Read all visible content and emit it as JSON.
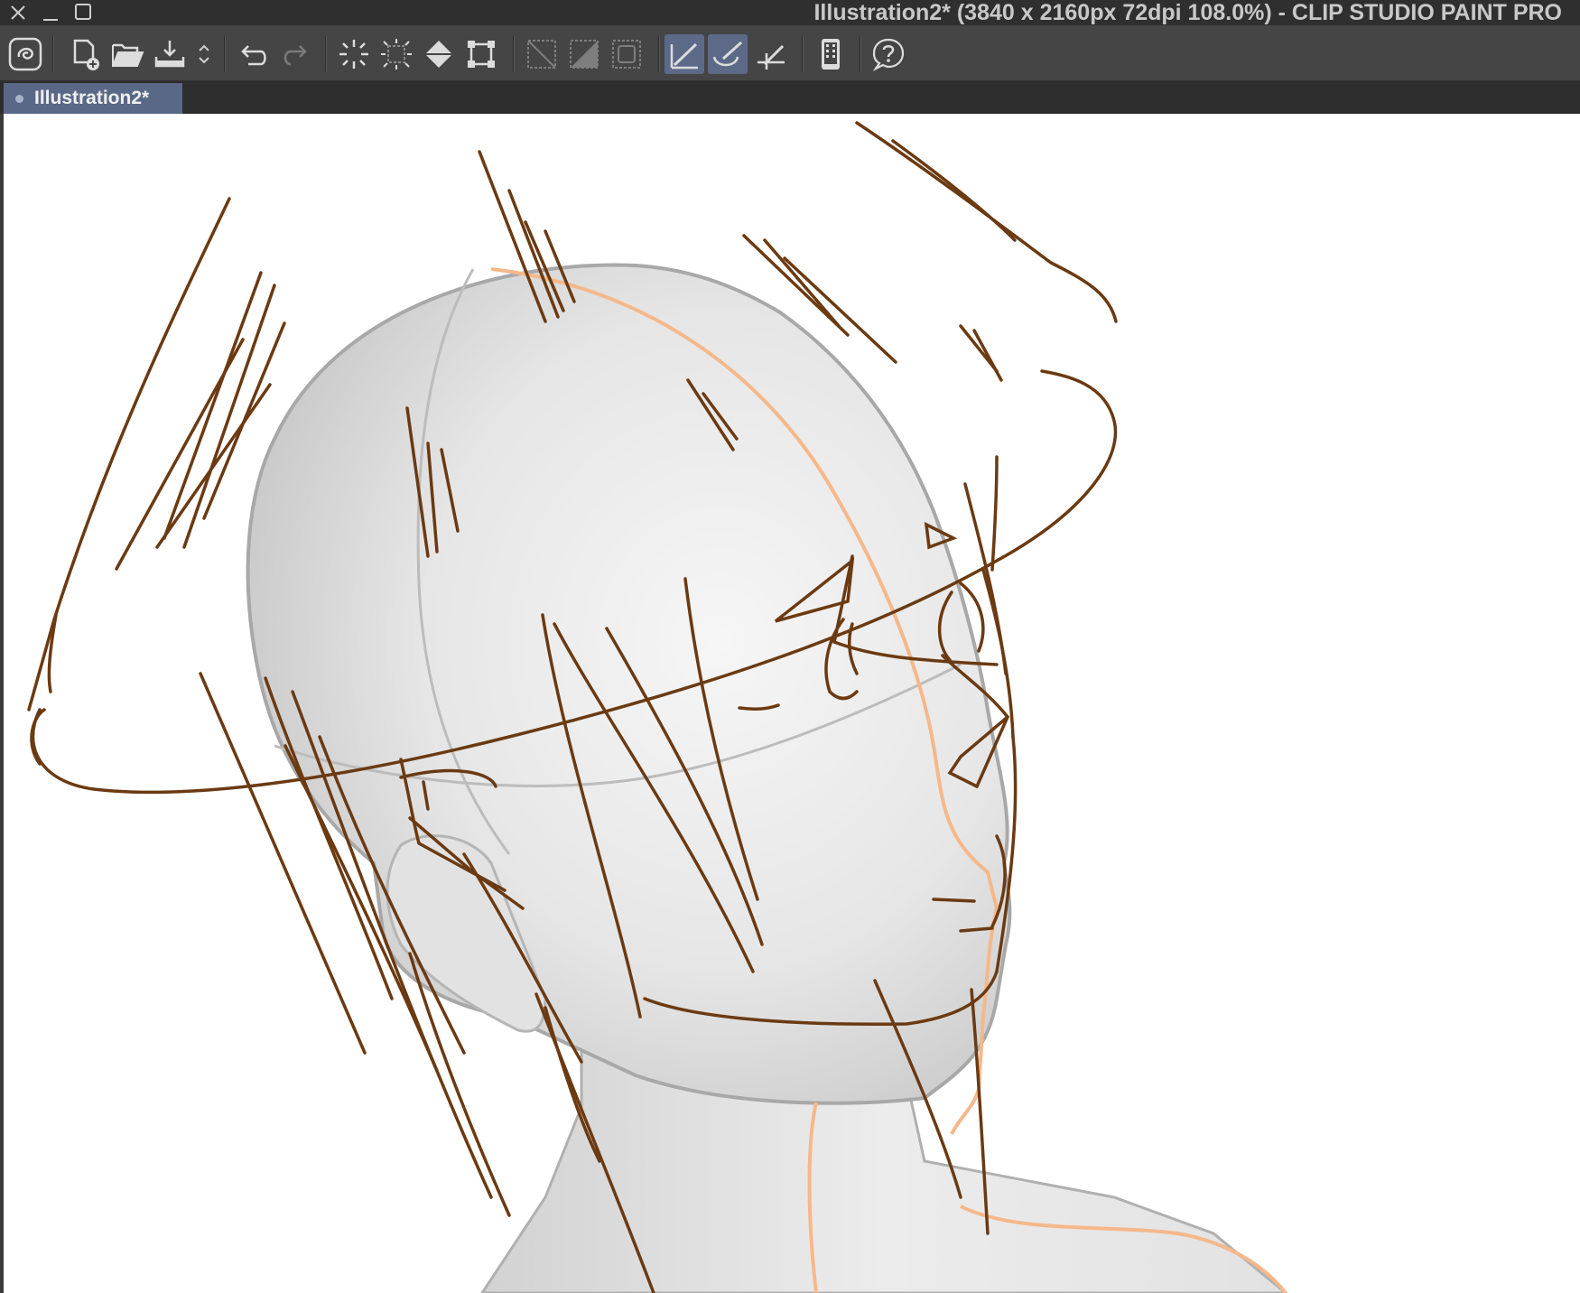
{
  "window": {
    "title": "Illustration2* (3840 x 2160px 72dpi 108.0%)  - CLIP STUDIO PAINT PRO",
    "controls": [
      "close-icon",
      "minimize-icon",
      "maximize-icon"
    ]
  },
  "toolbar": {
    "buttons": [
      {
        "name": "clip-studio-button",
        "icon": "swirl-logo-icon"
      },
      {
        "name": "new-button",
        "icon": "new-file-icon"
      },
      {
        "name": "open-button",
        "icon": "folder-open-icon"
      },
      {
        "name": "save-button",
        "icon": "save-icon"
      },
      {
        "name": "undo-button",
        "icon": "undo-icon"
      },
      {
        "name": "redo-button",
        "icon": "redo-icon"
      },
      {
        "name": "clear-button",
        "icon": "clear-burst-icon"
      },
      {
        "name": "clear-outside-selection-button",
        "icon": "clear-outside-icon"
      },
      {
        "name": "fill-button",
        "icon": "fill-bucket-icon"
      },
      {
        "name": "transform-button",
        "icon": "transform-icon"
      },
      {
        "name": "deselect-button",
        "icon": "deselect-icon"
      },
      {
        "name": "invert-selection-button",
        "icon": "invert-selection-icon"
      },
      {
        "name": "selection-border-button",
        "icon": "selection-border-icon"
      },
      {
        "name": "snap-to-ruler-button",
        "icon": "snap-ruler-icon",
        "active": true
      },
      {
        "name": "snap-to-special-ruler-button",
        "icon": "snap-special-ruler-icon",
        "active": true
      },
      {
        "name": "snap-to-grid-button",
        "icon": "snap-grid-icon"
      },
      {
        "name": "smartphone-button",
        "icon": "smartphone-icon"
      },
      {
        "name": "help-button",
        "icon": "help-icon"
      }
    ]
  },
  "tabs": [
    {
      "label": "Illustration2*",
      "active": true
    }
  ],
  "colors": {
    "sketch_line": "#6b3a12",
    "model_outline": "#a8a8a8",
    "model_centerline": "#f5b88a",
    "tab_active": "#5a6888",
    "button_active": "#5c6a88"
  }
}
